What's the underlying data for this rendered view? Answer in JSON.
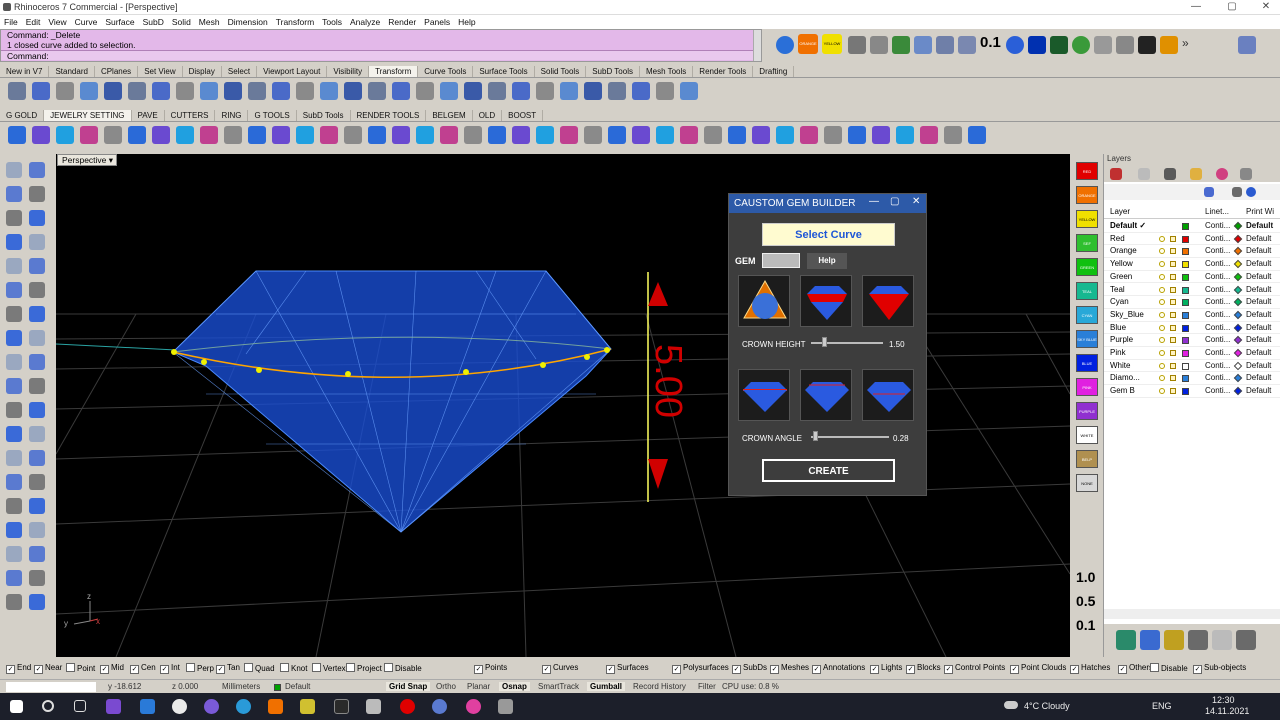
{
  "window": {
    "title": "Rhinoceros 7 Commercial - [Perspective]",
    "controls": [
      "—",
      "▢",
      "✕"
    ]
  },
  "menu": [
    "File",
    "Edit",
    "View",
    "Curve",
    "Surface",
    "SubD",
    "Solid",
    "Mesh",
    "Dimension",
    "Transform",
    "Tools",
    "Analyze",
    "Render",
    "Panels",
    "Help"
  ],
  "command": {
    "line1": "Command: _Delete",
    "line2": "1 closed curve added to selection.",
    "prompt": "Command:"
  },
  "top_icon_labels": {
    "orange": "ORANGE",
    "yellow": "YELLOW",
    "number": "0.1"
  },
  "toolbar_tabs": [
    "New in V7",
    "Standard",
    "CPlanes",
    "Set View",
    "Display",
    "Select",
    "Viewport Layout",
    "Visibility",
    "Transform",
    "Curve Tools",
    "Surface Tools",
    "Solid Tools",
    "SubD Tools",
    "Mesh Tools",
    "Render Tools",
    "Drafting"
  ],
  "active_toolbar_tab": "Transform",
  "plugin_tabs": [
    "G GOLD",
    "JEWELRY SETTING",
    "PAVE",
    "CUTTERS",
    "RING",
    "G TOOLS",
    "SubD Tools",
    "RENDER TOOLS",
    "BELGEM",
    "OLD",
    "BOOST"
  ],
  "active_plugin_tab": "JEWELRY SETTING",
  "viewport": {
    "label": "Perspective",
    "dimension": "5.00",
    "axis_z": "z",
    "axis_y": "y",
    "axis_x": "x"
  },
  "gem_panel": {
    "title": "CAUSTOM GEM BUILDER",
    "select_curve": "Select Curve",
    "gem_label": "GEM",
    "help": "Help",
    "crown_height_label": "CROWN HEIGHT",
    "crown_height_value": 1.5,
    "crown_height_display": "1.50",
    "crown_angle_label": "CROWN ANGLE",
    "crown_angle_value": 0.28,
    "crown_angle_display": "0.28",
    "create": "CREATE"
  },
  "color_strip": [
    {
      "label": "RED",
      "color": "#e00000"
    },
    {
      "label": "ORANGE",
      "color": "#f07000"
    },
    {
      "label": "YELLOW",
      "color": "#f0e000"
    },
    {
      "label": "SEF",
      "color": "#2fbf2f"
    },
    {
      "label": "GREEN",
      "color": "#10c010"
    },
    {
      "label": "TEAL",
      "color": "#16b890"
    },
    {
      "label": "CYAN",
      "color": "#28a8d8"
    },
    {
      "label": "SKY BLUE",
      "color": "#2a7fd8"
    },
    {
      "label": "BLUE",
      "color": "#0020e0"
    },
    {
      "label": "PINK",
      "color": "#e020e0"
    },
    {
      "label": "PURPLE",
      "color": "#9030d0"
    },
    {
      "label": "WHITE",
      "color": "#ffffff"
    },
    {
      "label": "BELP",
      "color": "#b09050"
    },
    {
      "label": "NONE",
      "color": "#d8d8d8"
    }
  ],
  "right_numbers": [
    "1.0",
    "0.5",
    "0.1"
  ],
  "layers": {
    "panel_title": "Layers",
    "col_layer": "Layer",
    "col_linetype": "Linet...",
    "col_print": "Print Wi",
    "rows": [
      {
        "name": "Default",
        "check": "✓",
        "color": "#00a000",
        "linetype": "Conti...",
        "print": "Default",
        "current": true
      },
      {
        "name": "Red",
        "color": "#e00000",
        "linetype": "Conti...",
        "print": "Default"
      },
      {
        "name": "Orange",
        "color": "#f07000",
        "linetype": "Conti...",
        "print": "Default"
      },
      {
        "name": "Yellow",
        "color": "#f0e000",
        "linetype": "Conti...",
        "print": "Default"
      },
      {
        "name": "Green",
        "color": "#10c010",
        "linetype": "Conti...",
        "print": "Default"
      },
      {
        "name": "Teal",
        "color": "#16b890",
        "linetype": "Conti...",
        "print": "Default"
      },
      {
        "name": "Cyan",
        "color": "#00b060",
        "linetype": "Conti...",
        "print": "Default"
      },
      {
        "name": "Sky_Blue",
        "color": "#2a7fd8",
        "linetype": "Conti...",
        "print": "Default"
      },
      {
        "name": "Blue",
        "color": "#0020e0",
        "linetype": "Conti...",
        "print": "Default"
      },
      {
        "name": "Purple",
        "color": "#9030d0",
        "linetype": "Conti...",
        "print": "Default"
      },
      {
        "name": "Pink",
        "color": "#e020e0",
        "linetype": "Conti...",
        "print": "Default"
      },
      {
        "name": "White",
        "color": "#ffffff",
        "linetype": "Conti...",
        "print": "Default"
      },
      {
        "name": "Diamo...",
        "color": "#2a7fd8",
        "linetype": "Conti...",
        "print": "Default"
      },
      {
        "name": "Gem B",
        "color": "#0020e0",
        "linetype": "Conti...",
        "print": "Default"
      }
    ]
  },
  "osnaps": [
    {
      "label": "End",
      "checked": true
    },
    {
      "label": "Near",
      "checked": true
    },
    {
      "label": "Point",
      "checked": false
    },
    {
      "label": "Mid",
      "checked": true
    },
    {
      "label": "Cen",
      "checked": true
    },
    {
      "label": "Int",
      "checked": true
    },
    {
      "label": "Perp",
      "checked": false
    },
    {
      "label": "Tan",
      "checked": true
    },
    {
      "label": "Quad",
      "checked": false
    },
    {
      "label": "Knot",
      "checked": false
    },
    {
      "label": "Vertex",
      "checked": false
    },
    {
      "label": "Project",
      "checked": false
    },
    {
      "label": "Disable",
      "checked": false
    }
  ],
  "filters": [
    "Points",
    "Curves",
    "Surfaces",
    "Polysurfaces",
    "SubDs",
    "Meshes",
    "Annotations",
    "Lights",
    "Blocks",
    "Control Points",
    "Point Clouds",
    "Hatches",
    "Others",
    "Disable",
    "Sub-objects"
  ],
  "status": {
    "y": "y -18.612",
    "z": "z 0.000",
    "units": "Millimeters",
    "layer": "Default",
    "grid_snap": "Grid Snap",
    "ortho": "Ortho",
    "planar": "Planar",
    "osnap": "Osnap",
    "smarttrack": "SmartTrack",
    "gumball": "Gumball",
    "record": "Record History",
    "filter": "Filter",
    "cpu": "CPU use: 0.8 %"
  },
  "taskbar": {
    "weather": "4°C  Cloudy",
    "lang": "ENG",
    "time": "12:30",
    "date": "14.11.2021"
  }
}
